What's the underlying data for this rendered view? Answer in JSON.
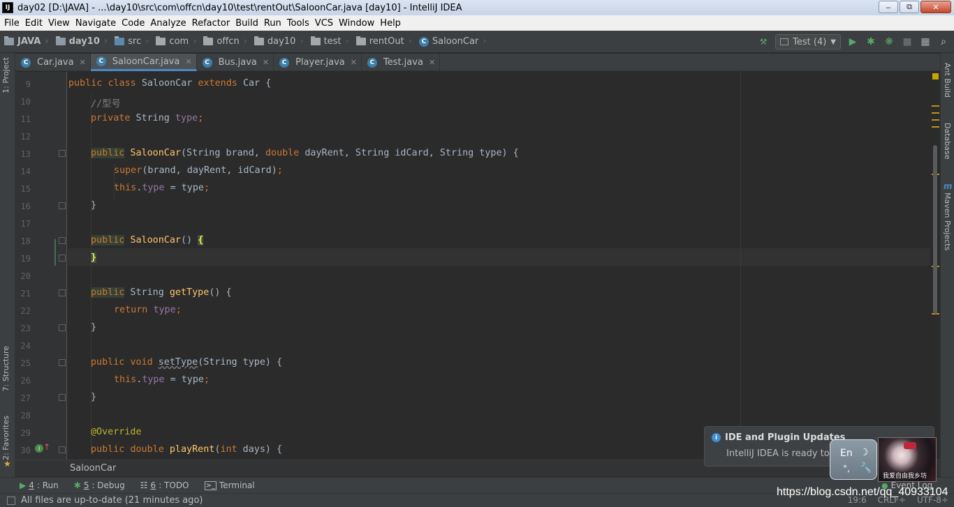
{
  "window": {
    "title": "day02 [D:\\JAVA] - ...\\day10\\src\\com\\offcn\\day10\\test\\rentOut\\SaloonCar.java [day10] - IntelliJ IDEA",
    "app_icon": "IJ",
    "minimize": "‒",
    "maximize": "⧉",
    "close": "✕"
  },
  "menu": [
    "File",
    "Edit",
    "View",
    "Navigate",
    "Code",
    "Analyze",
    "Refactor",
    "Build",
    "Run",
    "Tools",
    "VCS",
    "Window",
    "Help"
  ],
  "breadcrumb": [
    "JAVA",
    "day10",
    "src",
    "com",
    "offcn",
    "day10",
    "test",
    "rentOut",
    "SaloonCar"
  ],
  "run_config": {
    "label": "Test (4)"
  },
  "tabs": [
    {
      "label": "Car.java"
    },
    {
      "label": "SaloonCar.java"
    },
    {
      "label": "Bus.java"
    },
    {
      "label": "Player.java"
    },
    {
      "label": "Test.java"
    }
  ],
  "left_tools": {
    "project": "1: Project",
    "structure": "7: Structure",
    "favorites": "2: Favorites"
  },
  "right_tools": {
    "ant": "Ant Build",
    "database": "Database",
    "maven": "Maven Projects"
  },
  "line_numbers": [
    "9",
    "10",
    "11",
    "12",
    "13",
    "14",
    "15",
    "16",
    "17",
    "18",
    "19",
    "20",
    "21",
    "22",
    "23",
    "24",
    "25",
    "26",
    "27",
    "28",
    "29",
    "30"
  ],
  "code": {
    "l9": [
      "public",
      "class",
      "SaloonCar",
      "extends",
      "Car",
      "{"
    ],
    "l10": "//型号",
    "l11": [
      "private",
      "String",
      "type",
      ";"
    ],
    "l13": [
      "public",
      "SaloonCar",
      "(String brand, ",
      "double",
      " dayRent, String idCard, String type) {"
    ],
    "l14": [
      "super",
      "(brand, dayRent, idCard)",
      ";"
    ],
    "l15": [
      "this",
      ".",
      "type",
      " = type",
      ";"
    ],
    "l16": "}",
    "l18": [
      "public",
      "SaloonCar",
      "() ",
      "{"
    ],
    "l19": "}",
    "l21": [
      "public",
      " String ",
      "getType",
      "() {"
    ],
    "l22": [
      "return",
      "type",
      ";"
    ],
    "l23": "}",
    "l25": [
      "public",
      "void",
      "setType",
      "(String type) {"
    ],
    "l26": [
      "this",
      ".",
      "type",
      " = type",
      ";"
    ],
    "l27": "}",
    "l29": "@Override",
    "l30": [
      "public",
      "double",
      "playRent",
      "(",
      "int",
      " days) {"
    ]
  },
  "struct_crumb": "SaloonCar",
  "bottom_tools": [
    {
      "num": "4",
      "label": ": Run",
      "icon": "run-icon"
    },
    {
      "num": "5",
      "label": ": Debug",
      "icon": "debug-icon"
    },
    {
      "num": "6",
      "label": ": TODO",
      "icon": "todo-icon"
    },
    {
      "num": "",
      "label": "Terminal",
      "icon": "terminal-icon"
    }
  ],
  "status": {
    "message": "All files are up-to-date (21 minutes ago)",
    "position": "19:6",
    "line_sep": "CRLF÷",
    "encoding": "UTF-8÷"
  },
  "notification": {
    "title": "IDE and Plugin Updates",
    "body": "IntelliJ IDEA is ready to ",
    "link": "u"
  },
  "ime": {
    "lang": "En",
    "moon": "☽",
    "dots": "°,",
    "wrench": "🔧"
  },
  "avatar_caption": "我爱自由我乡坊",
  "event_log": "Event Log",
  "watermark": "https://blog.csdn.net/qq_40933104",
  "colors": {
    "keyword": "#cc7832",
    "function": "#ffc66d",
    "field": "#9876aa",
    "comment": "#808080",
    "annotation": "#bbb529",
    "accent": "#4a88c7"
  }
}
